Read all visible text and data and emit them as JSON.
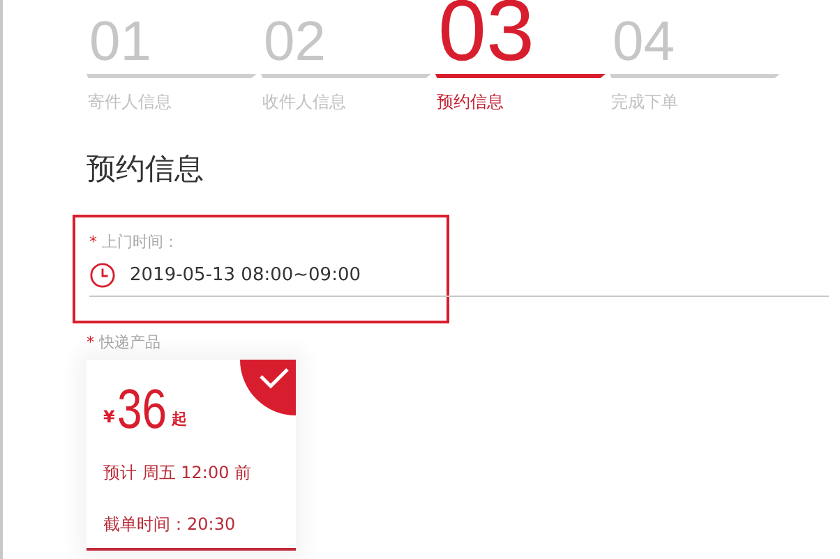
{
  "steps": [
    {
      "number": "01",
      "label": "寄件人信息",
      "selected": false
    },
    {
      "number": "02",
      "label": "收件人信息",
      "selected": false
    },
    {
      "number": "03",
      "label": "预约信息",
      "selected": true
    },
    {
      "number": "04",
      "label": "完成下单",
      "selected": false
    }
  ],
  "section_title": "预约信息",
  "pickup_time": {
    "required_mark": "*",
    "label": "上门时间：",
    "value": "2019-05-13 08:00~09:00",
    "highlighted": true
  },
  "product": {
    "required_mark": "*",
    "label": "快递产品",
    "cards": [
      {
        "currency": "¥",
        "price": "36",
        "suffix": "起",
        "eta": "预计 周五 12:00 前",
        "cutoff": "截单时间：20:30",
        "selected": true
      }
    ]
  }
}
